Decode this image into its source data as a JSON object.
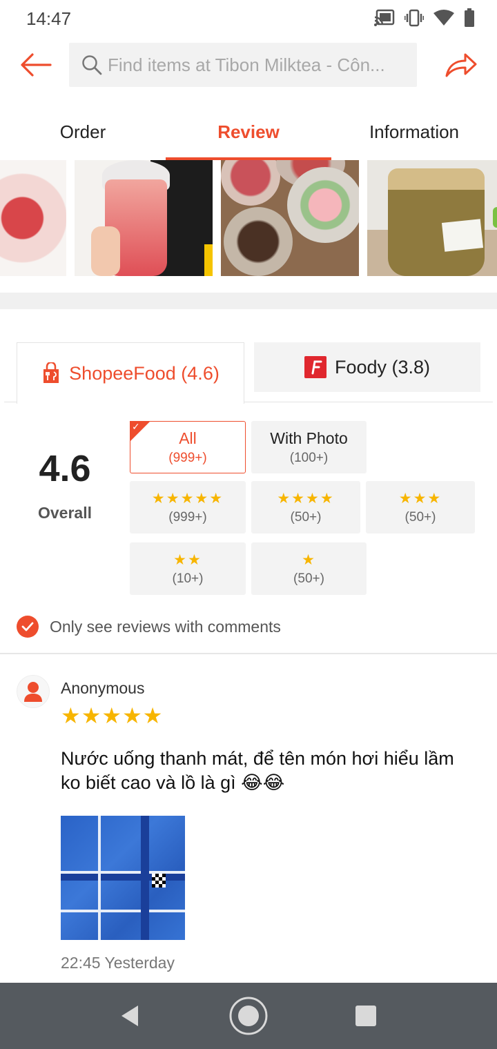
{
  "status_bar": {
    "time": "14:47",
    "icons": [
      "cast-icon",
      "vibrate-icon",
      "wifi-icon",
      "battery-icon"
    ]
  },
  "header": {
    "search_placeholder": "Find items at Tibon Milktea - Côn...",
    "back_icon": "arrow-left-icon",
    "share_icon": "share-icon"
  },
  "tabs": [
    {
      "label": "Order",
      "active": false
    },
    {
      "label": "Review",
      "active": true
    },
    {
      "label": "Information",
      "active": false
    }
  ],
  "source_tabs": {
    "shopee": {
      "label": "ShopeeFood (4.6)",
      "active": true
    },
    "foody": {
      "label": "Foody (3.8)",
      "active": false
    }
  },
  "rating": {
    "score": "4.6",
    "label": "Overall"
  },
  "filters": {
    "all": {
      "label": "All",
      "count": "(999+)",
      "selected": true
    },
    "with_photo": {
      "label": "With Photo",
      "count": "(100+)"
    },
    "five_star": {
      "stars": "★★★★★",
      "count": "(999+)"
    },
    "four_star": {
      "stars": "★★★★",
      "count": "(50+)"
    },
    "three_star": {
      "stars": "★★★",
      "count": "(50+)"
    },
    "two_star": {
      "stars": "★★",
      "count": "(10+)"
    },
    "one_star": {
      "stars": "★",
      "count": "(50+)"
    }
  },
  "comments_only": {
    "label": "Only see reviews with comments",
    "checked": true
  },
  "review": {
    "name": "Anonymous",
    "stars": "★★★★★",
    "rating": 5,
    "text": "Nước uống thanh mát, để tên món hơi hiểu lầm ko biết cao và lồ là gì 😂😂",
    "time": "22:45 Yesterday"
  },
  "colors": {
    "accent": "#ee4d2d",
    "star": "#f7b500",
    "nav_bar": "#555a5f"
  }
}
